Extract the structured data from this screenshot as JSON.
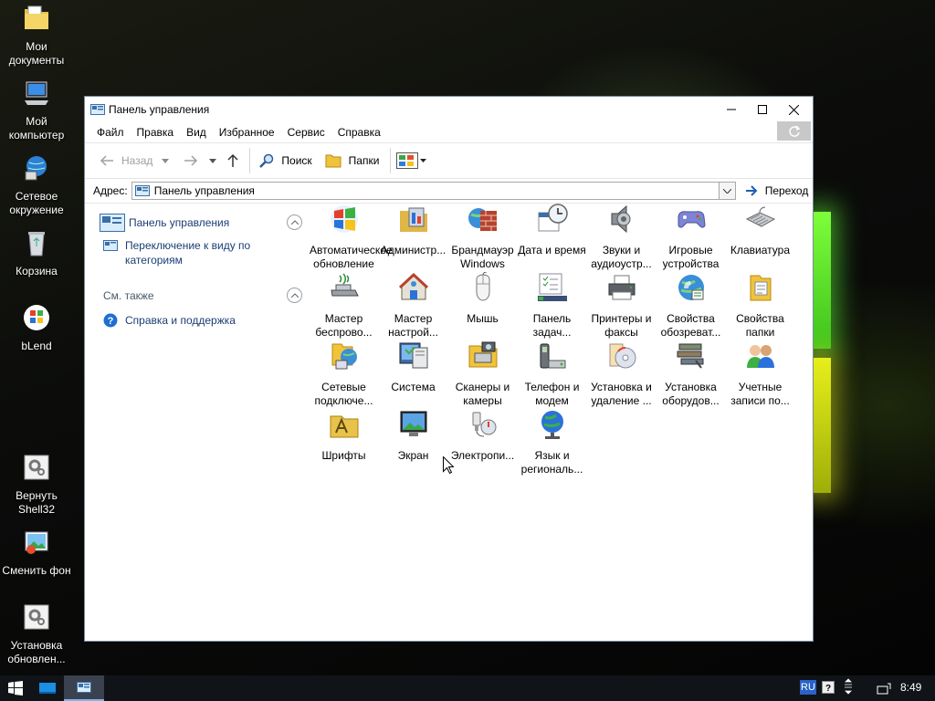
{
  "desktop": {
    "icons": [
      {
        "label": "Мои документы",
        "icon": "my-documents-icon"
      },
      {
        "label": "Мой компьютер",
        "icon": "my-computer-icon"
      },
      {
        "label": "Сетевое окружение",
        "icon": "network-icon"
      },
      {
        "label": "Корзина",
        "icon": "recycle-bin-icon"
      },
      {
        "label": "bLend",
        "icon": "blend-icon"
      },
      {
        "label": "Вернуть Shell32",
        "icon": "shell32-icon"
      },
      {
        "label": "Сменить фон",
        "icon": "change-wallpaper-icon"
      },
      {
        "label": "Установка обновлен...",
        "icon": "install-updates-icon"
      }
    ]
  },
  "window": {
    "title": "Панель управления",
    "menu": [
      "Файл",
      "Правка",
      "Вид",
      "Избранное",
      "Сервис",
      "Справка"
    ],
    "toolbar": {
      "back": "Назад",
      "search": "Поиск",
      "folders": "Папки"
    },
    "address": {
      "label": "Адрес:",
      "value": "Панель управления",
      "go": "Переход"
    },
    "tasks": {
      "panel_title": "Панель управления",
      "switch_view": "Переключение к виду по категориям",
      "see_also": "См. также",
      "help": "Справка и поддержка"
    },
    "items": [
      {
        "label": "Автоматическое обновление",
        "icon": "windows-update-icon"
      },
      {
        "label": "Администр...",
        "icon": "admin-tools-icon"
      },
      {
        "label": "Брандмауэр Windows",
        "icon": "firewall-icon"
      },
      {
        "label": "Дата и время",
        "icon": "date-time-icon"
      },
      {
        "label": "Звуки и аудиоустр...",
        "icon": "sound-icon"
      },
      {
        "label": "Игровые устройства",
        "icon": "game-controller-icon"
      },
      {
        "label": "Клавиатура",
        "icon": "keyboard-icon"
      },
      {
        "label": "Мастер беспрово...",
        "icon": "wireless-wizard-icon"
      },
      {
        "label": "Мастер настрой...",
        "icon": "network-setup-icon"
      },
      {
        "label": "Мышь",
        "icon": "mouse-icon"
      },
      {
        "label": "Панель задач...",
        "icon": "taskbar-icon"
      },
      {
        "label": "Принтеры и факсы",
        "icon": "printer-icon"
      },
      {
        "label": "Свойства обозреват...",
        "icon": "internet-options-icon"
      },
      {
        "label": "Свойства папки",
        "icon": "folder-options-icon"
      },
      {
        "label": "Сетевые подключе...",
        "icon": "network-connections-icon"
      },
      {
        "label": "Система",
        "icon": "system-icon"
      },
      {
        "label": "Сканеры и камеры",
        "icon": "scanner-icon"
      },
      {
        "label": "Телефон и модем",
        "icon": "phone-modem-icon"
      },
      {
        "label": "Установка и удаление ...",
        "icon": "add-remove-icon"
      },
      {
        "label": "Установка оборудов...",
        "icon": "add-hardware-icon"
      },
      {
        "label": "Учетные записи по...",
        "icon": "user-accounts-icon"
      },
      {
        "label": "Шрифты",
        "icon": "fonts-icon"
      },
      {
        "label": "Экран",
        "icon": "display-icon"
      },
      {
        "label": "Электропи...",
        "icon": "power-options-icon"
      },
      {
        "label": "Язык и региональ...",
        "icon": "regional-icon"
      }
    ]
  },
  "taskbar": {
    "lang": "RU",
    "time": "8:49"
  },
  "colors": {
    "link": "#1b3d73",
    "accent": "#0a64c8"
  }
}
